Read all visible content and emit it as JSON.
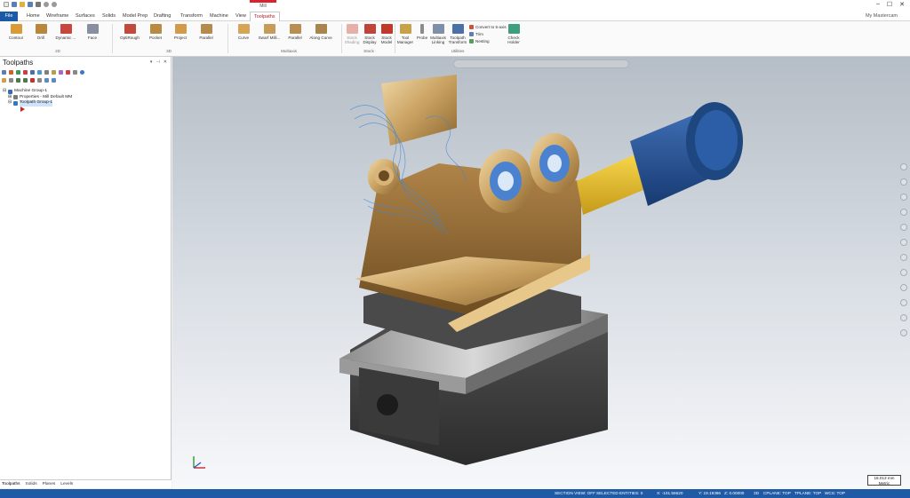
{
  "titlebar": {
    "context_tab": "Mill",
    "user": "My Mastercam"
  },
  "tabs": [
    "File",
    "Home",
    "Wireframe",
    "Surfaces",
    "Solids",
    "Model Prep",
    "Drafting",
    "Transform",
    "Machine",
    "View",
    "Toolpaths"
  ],
  "active_tab": "Toolpaths",
  "ribbon": {
    "groups": {
      "g2d": "2D",
      "g3d": "3D",
      "multiaxis": "Multiaxis",
      "stock": "Stock",
      "utilities": "Utilities"
    },
    "buttons": {
      "contour": "Contour",
      "drill": "Drill",
      "dynamic": "Dynamic ...",
      "face": "Face",
      "optirough": "OptiRough",
      "pocket": "Pocket",
      "project": "Project",
      "parallel3d": "Parallel",
      "curve": "Curve",
      "swarf": "Swarf Milli...",
      "parallel_ma": "Parallel",
      "along_curve": "Along Curve",
      "stock_shading": "Stock Shading",
      "stock_display": "Stock Display",
      "stock_model": "Stock Model",
      "tool_manager": "Tool Manager",
      "probe": "Probe",
      "multiaxis_linking": "Multiaxis Linking",
      "toolpath_transform": "Toolpath Transform",
      "convert_5axis": "Convert to 5-axis",
      "trim": "Trim",
      "nesting": "Nesting",
      "check_holder": "Check Holder"
    }
  },
  "panel": {
    "title": "Toolpaths",
    "tree": [
      {
        "label": "Machine Group-1"
      },
      {
        "label": "Properties - Mill Default MM"
      },
      {
        "label": "Toolpath Group-1"
      }
    ],
    "bottom_tabs": [
      "Toolpaths",
      "Solids",
      "Planes",
      "Levels"
    ]
  },
  "viewport": {
    "scale_value": "18.013 mm",
    "scale_unit": "Metric"
  },
  "status": {
    "section_view": "SECTION VIEW: OFF",
    "selected_entities": "SELECTED ENTITIES: 0",
    "x": "X:  -101.55620",
    "y": "Y:  19.19396",
    "z": "Z:  0.00000",
    "mode": "3D",
    "cplane": "CPLANE: TOP",
    "tplane": "TPLANE: TOP",
    "wcs": "WCS: TOP"
  },
  "colors": {
    "accent": "#1e5aa6",
    "context": "#d9232e",
    "bronze": "#c8a060",
    "spindle": "#1f4a8a"
  }
}
